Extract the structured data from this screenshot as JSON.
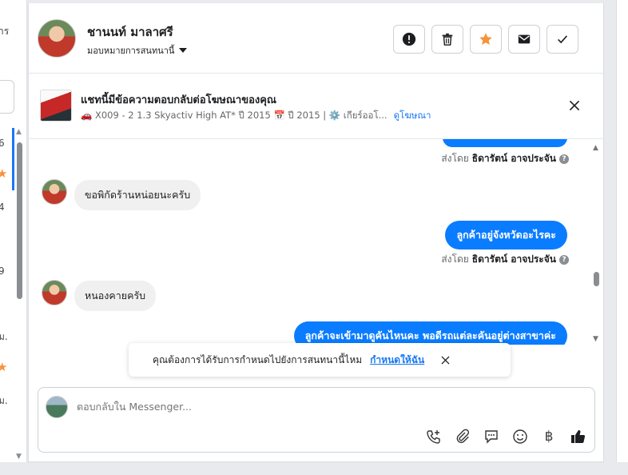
{
  "left_fragments": [
    "าร",
    "6",
    "4",
    "9",
    "ม.",
    "ม."
  ],
  "header": {
    "name": "ชานนท์ มาลาศรี",
    "assign_label": "มอบหมายการสนทนานี้",
    "actions": [
      "spam-report",
      "delete",
      "star",
      "mark-unread",
      "mark-done"
    ]
  },
  "ad": {
    "title": "แชทนี้มีข้อความตอบกลับต่อโฆษณาของคุณ",
    "details": "🚗 X009 - 2 1.3 Skyactiv High AT* ปี 2015 📅 ปี 2015 | ⚙️ เกียร์ออโ...",
    "link": "ดูโฆษณา"
  },
  "messages": [
    {
      "dir": "out",
      "text": "",
      "partial": true
    },
    {
      "type": "sent_by",
      "prefix": "ส่งโดย",
      "name": "ธิดารัตน์ อาจประจัน",
      "q": "?"
    },
    {
      "dir": "in",
      "text": "ขอพิกัดร้านหน่อยนะครับ"
    },
    {
      "dir": "out",
      "text": "ลูกค้าอยู่จังหวัดอะไรคะ"
    },
    {
      "type": "sent_by",
      "prefix": "ส่งโดย",
      "name": "ธิดารัตน์ อาจประจัน",
      "q": "?"
    },
    {
      "dir": "in",
      "text": "หนองคายครับ"
    },
    {
      "dir": "out",
      "text": "ลูกค้าจะเข้ามาดูคันไหนคะ พอดีรถแต่ละคันอยู่ต่างสาขาค่ะ"
    }
  ],
  "assign_prompt": {
    "text": "คุณต้องการได้รับการกำหนดไปยังการสนทนานี้ไหม",
    "link": "กำหนดให้ฉัน"
  },
  "composer": {
    "placeholder": "ตอบกลับใน Messenger...",
    "tools": [
      "call-add-icon",
      "attachment-icon",
      "saved-reply-icon",
      "emoji-icon",
      "baht-payment-icon",
      "like-icon"
    ],
    "baht_glyph": "฿"
  },
  "colors": {
    "accent": "#0a7cff",
    "link": "#1877f2",
    "star": "#f7923a"
  }
}
